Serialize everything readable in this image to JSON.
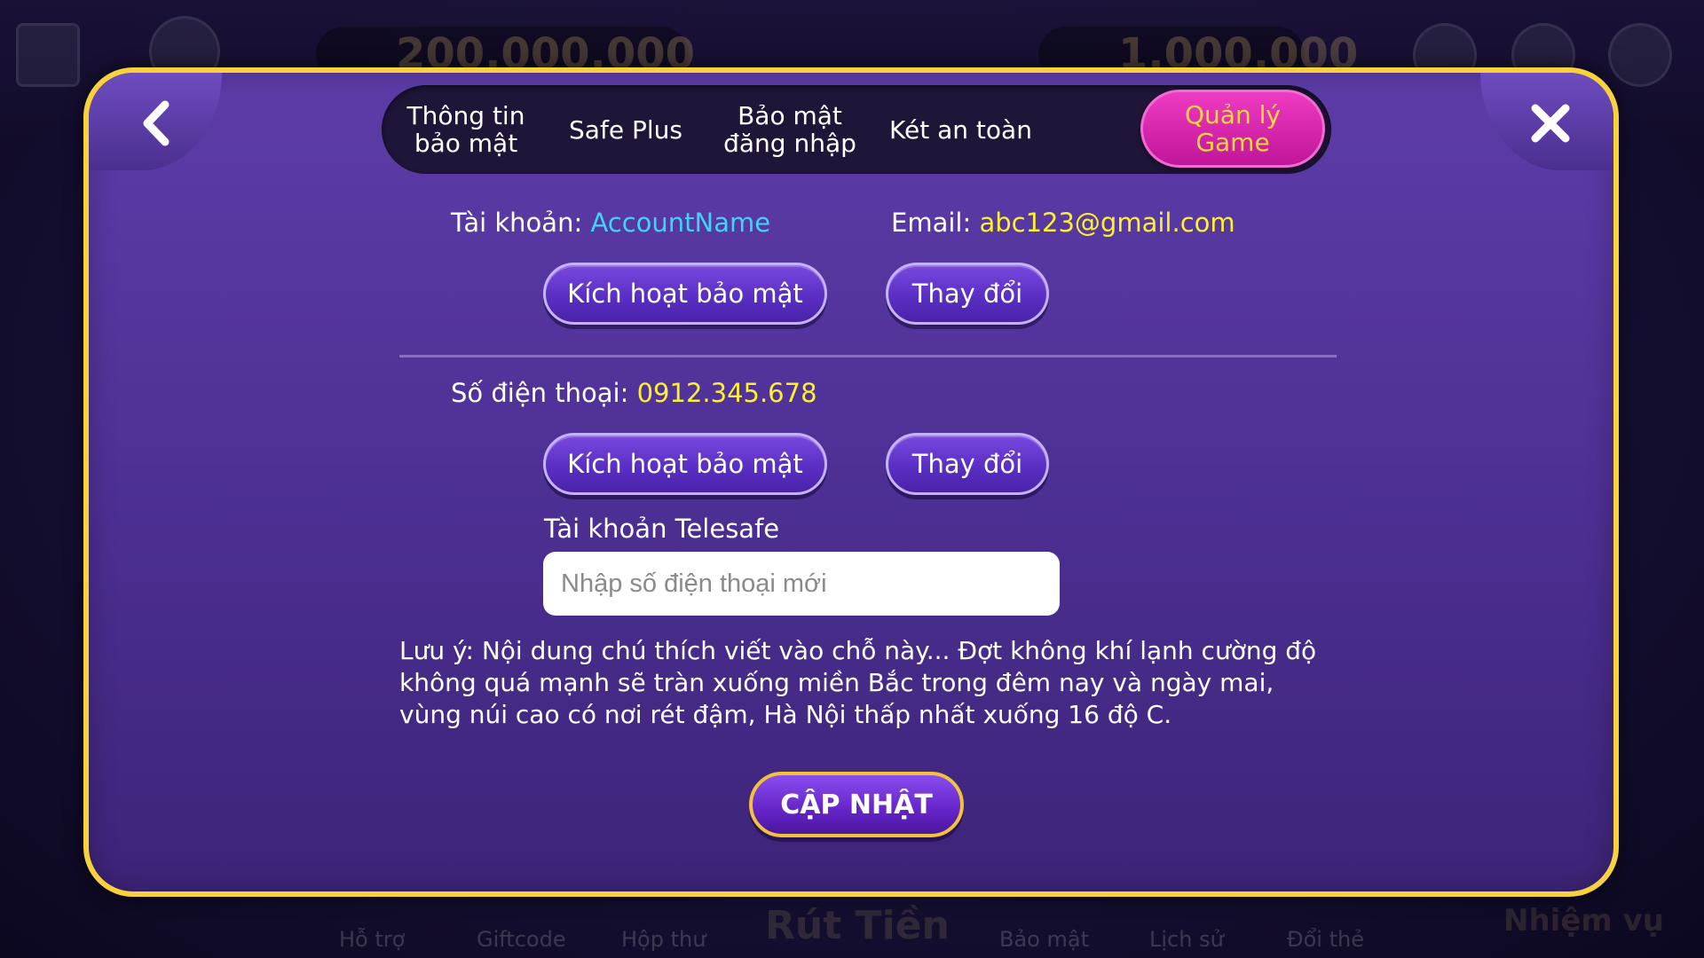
{
  "background": {
    "balance_gold": "200.000.000",
    "balance_silver": "1.000.000",
    "bottom_nav": [
      "Hỗ trợ",
      "Giftcode",
      "Hộp thư",
      "Rút Tiền",
      "Bảo mật",
      "Lịch sử",
      "Đổi thẻ",
      "Nhiệm vụ"
    ]
  },
  "tabs": [
    {
      "label": "Thông tin\nbảo mật",
      "active": false
    },
    {
      "label": "Safe Plus",
      "active": false
    },
    {
      "label": "Bảo mật\nđăng nhập",
      "active": false
    },
    {
      "label": "Két an toàn",
      "active": false
    },
    {
      "label": "Quản lý\nGame",
      "active": true
    }
  ],
  "account": {
    "label": "Tài khoản:",
    "value": "AccountName",
    "email_label": "Email:",
    "email_value": "abc123@gmail.com",
    "activate_label": "Kích hoạt bảo mật",
    "change_label": "Thay đổi"
  },
  "phone": {
    "label": "Số điện thoại:",
    "value": "0912.345.678",
    "activate_label": "Kích hoạt bảo mật",
    "change_label": "Thay đổi"
  },
  "telesafe": {
    "label": "Tài khoản Telesafe",
    "placeholder": "Nhập số điện thoại mới",
    "value": ""
  },
  "note": "Lưu ý: Nội dung chú thích viết vào chỗ này... Đợt không khí lạnh cường độ không quá mạnh sẽ tràn xuống miền Bắc trong đêm nay và ngày mai, vùng núi cao có nơi rét đậm, Hà Nội thấp nhất xuống 16 độ C.",
  "update_label": "CẬP NHẬT",
  "colors": {
    "frame_border": "#f7d23c",
    "panel": "#4f3197",
    "active_tab": "#d622ae",
    "active_tab_text": "#ffd83a",
    "account_value": "#41d3f5",
    "highlight_value": "#fcf12c"
  },
  "icons": {
    "back": "chevron-left-icon",
    "close": "close-icon"
  }
}
